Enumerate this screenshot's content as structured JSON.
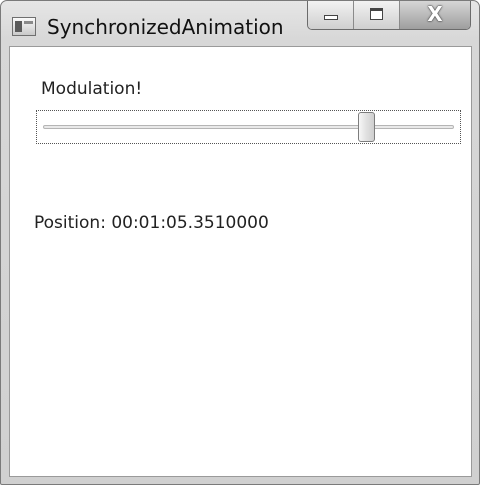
{
  "window": {
    "title": "SynchronizedAnimation",
    "icon": "app-window-icon",
    "buttons": {
      "minimize_icon": "minimize-icon",
      "maximize_icon": "maximize-icon",
      "close_icon": "close-icon",
      "close_glyph": "X"
    }
  },
  "content": {
    "slider_label": "Modulation!",
    "slider_value_fraction": 0.8,
    "position_text": "Position: 00:01:05.3510000"
  }
}
